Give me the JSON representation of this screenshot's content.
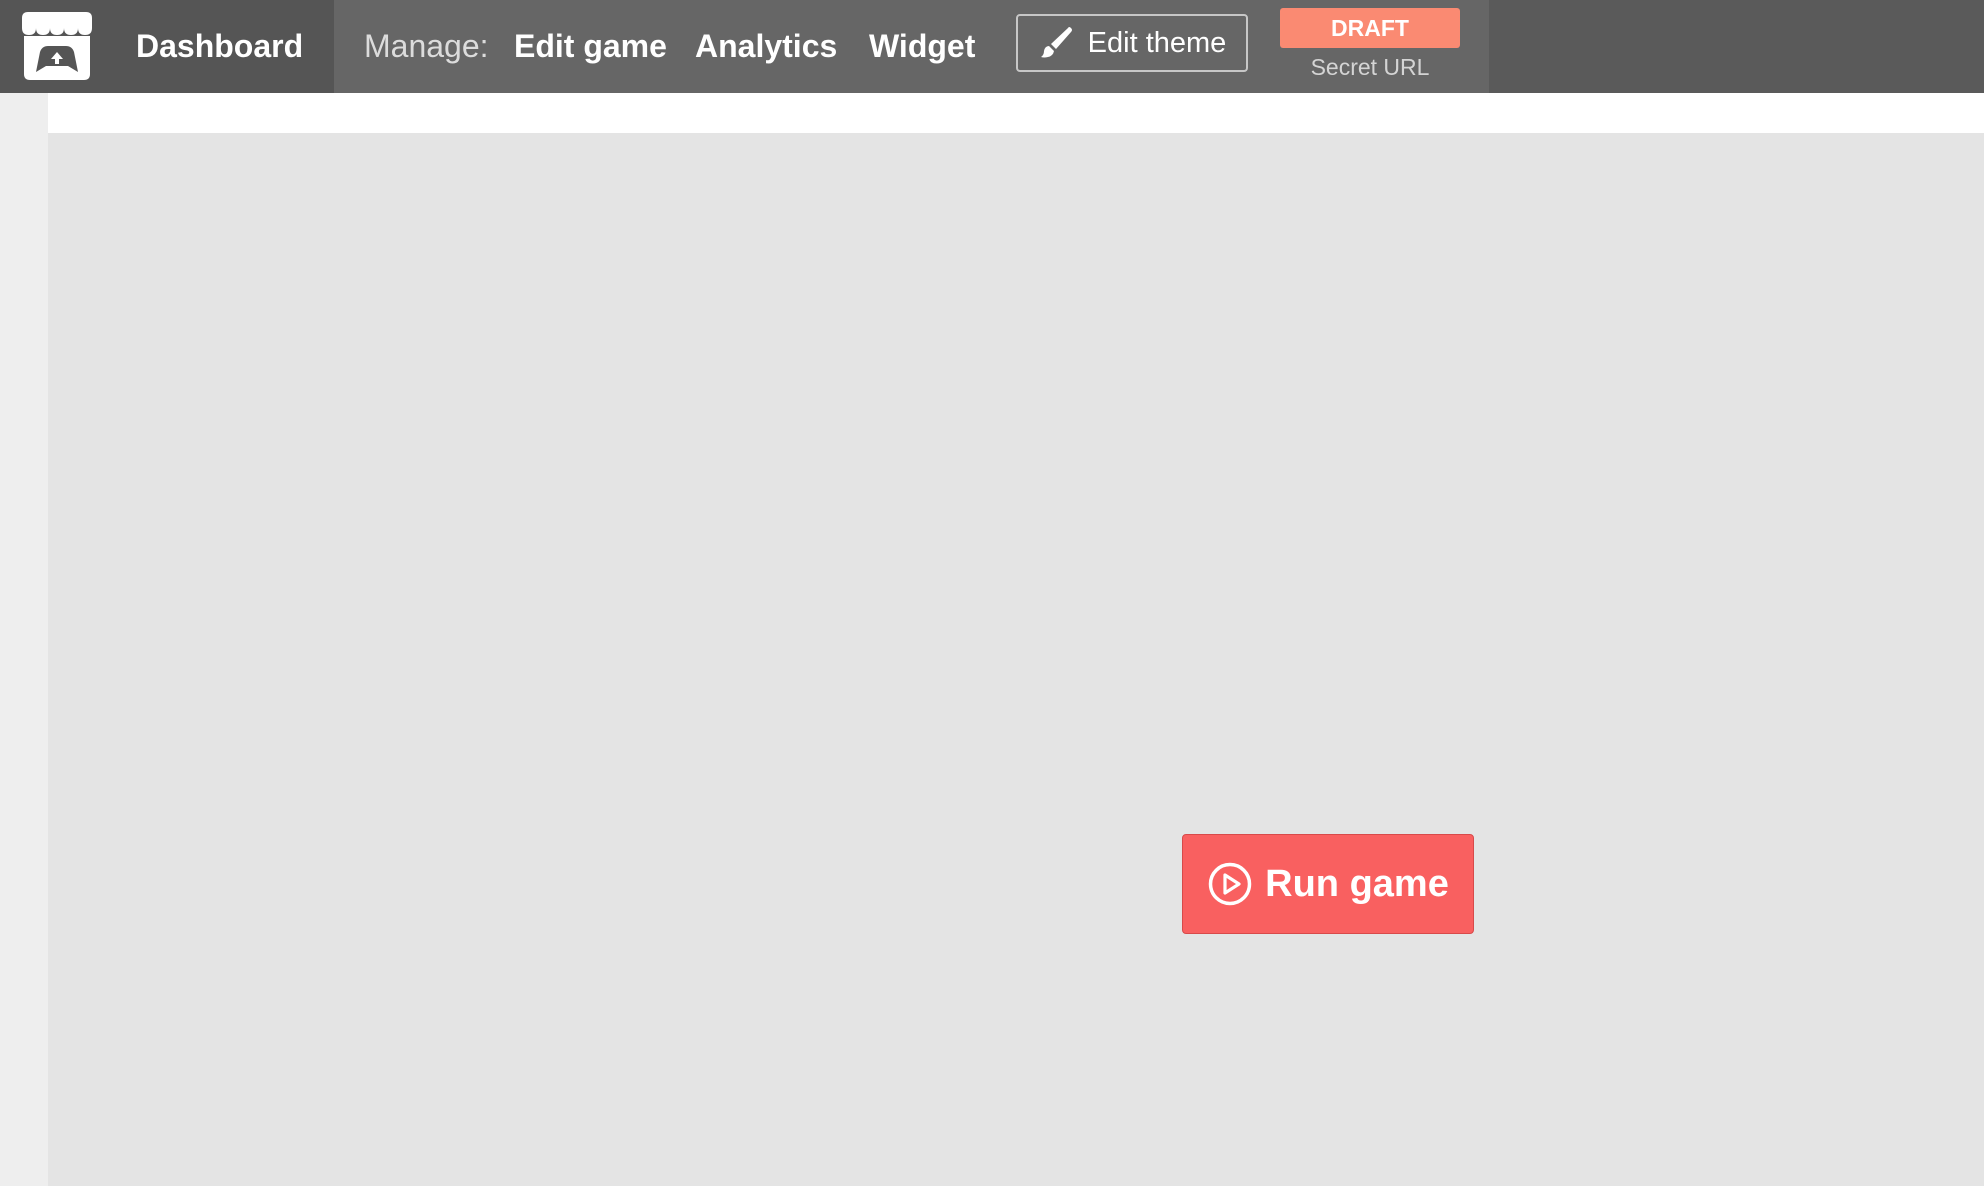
{
  "topbar": {
    "dashboard_label": "Dashboard",
    "manage_label": "Manage:",
    "nav": [
      {
        "label": "Edit game"
      },
      {
        "label": "Analytics"
      },
      {
        "label": "Widget"
      }
    ],
    "edit_theme_label": "Edit theme",
    "draft_badge": "DRAFT",
    "secret_url_label": "Secret URL"
  },
  "main": {
    "run_game_label": "Run game"
  },
  "icons": {
    "logo": "itch-store-icon",
    "edit_theme": "paintbrush-icon",
    "run_game": "play-circle-icon"
  },
  "colors": {
    "topbar": "#5a5a5a",
    "manage_bar": "#666666",
    "draft_badge": "#fa8a72",
    "run_button": "#f96060",
    "frame": "#e4e4e4"
  }
}
